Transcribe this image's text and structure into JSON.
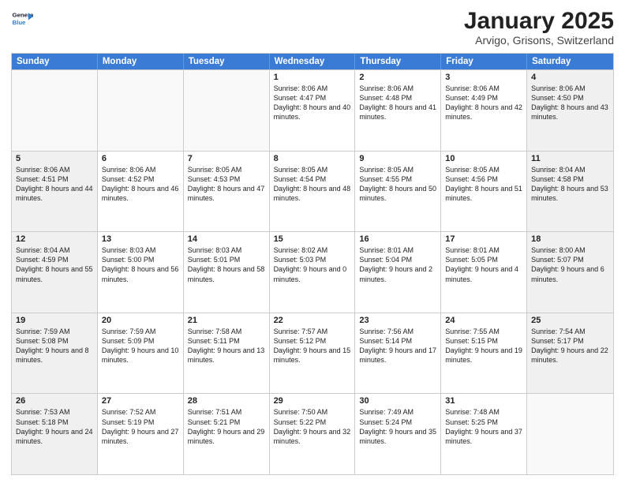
{
  "header": {
    "logo_line1": "General",
    "logo_line2": "Blue",
    "title": "January 2025",
    "subtitle": "Arvigo, Grisons, Switzerland"
  },
  "days_of_week": [
    "Sunday",
    "Monday",
    "Tuesday",
    "Wednesday",
    "Thursday",
    "Friday",
    "Saturday"
  ],
  "weeks": [
    [
      {
        "day": "",
        "text": "",
        "empty": true
      },
      {
        "day": "",
        "text": "",
        "empty": true
      },
      {
        "day": "",
        "text": "",
        "empty": true
      },
      {
        "day": "1",
        "text": "Sunrise: 8:06 AM\nSunset: 4:47 PM\nDaylight: 8 hours and 40 minutes.",
        "empty": false
      },
      {
        "day": "2",
        "text": "Sunrise: 8:06 AM\nSunset: 4:48 PM\nDaylight: 8 hours and 41 minutes.",
        "empty": false
      },
      {
        "day": "3",
        "text": "Sunrise: 8:06 AM\nSunset: 4:49 PM\nDaylight: 8 hours and 42 minutes.",
        "empty": false
      },
      {
        "day": "4",
        "text": "Sunrise: 8:06 AM\nSunset: 4:50 PM\nDaylight: 8 hours and 43 minutes.",
        "empty": false,
        "shaded": true
      }
    ],
    [
      {
        "day": "5",
        "text": "Sunrise: 8:06 AM\nSunset: 4:51 PM\nDaylight: 8 hours and 44 minutes.",
        "empty": false,
        "shaded": true
      },
      {
        "day": "6",
        "text": "Sunrise: 8:06 AM\nSunset: 4:52 PM\nDaylight: 8 hours and 46 minutes.",
        "empty": false
      },
      {
        "day": "7",
        "text": "Sunrise: 8:05 AM\nSunset: 4:53 PM\nDaylight: 8 hours and 47 minutes.",
        "empty": false
      },
      {
        "day": "8",
        "text": "Sunrise: 8:05 AM\nSunset: 4:54 PM\nDaylight: 8 hours and 48 minutes.",
        "empty": false
      },
      {
        "day": "9",
        "text": "Sunrise: 8:05 AM\nSunset: 4:55 PM\nDaylight: 8 hours and 50 minutes.",
        "empty": false
      },
      {
        "day": "10",
        "text": "Sunrise: 8:05 AM\nSunset: 4:56 PM\nDaylight: 8 hours and 51 minutes.",
        "empty": false
      },
      {
        "day": "11",
        "text": "Sunrise: 8:04 AM\nSunset: 4:58 PM\nDaylight: 8 hours and 53 minutes.",
        "empty": false,
        "shaded": true
      }
    ],
    [
      {
        "day": "12",
        "text": "Sunrise: 8:04 AM\nSunset: 4:59 PM\nDaylight: 8 hours and 55 minutes.",
        "empty": false,
        "shaded": true
      },
      {
        "day": "13",
        "text": "Sunrise: 8:03 AM\nSunset: 5:00 PM\nDaylight: 8 hours and 56 minutes.",
        "empty": false
      },
      {
        "day": "14",
        "text": "Sunrise: 8:03 AM\nSunset: 5:01 PM\nDaylight: 8 hours and 58 minutes.",
        "empty": false
      },
      {
        "day": "15",
        "text": "Sunrise: 8:02 AM\nSunset: 5:03 PM\nDaylight: 9 hours and 0 minutes.",
        "empty": false
      },
      {
        "day": "16",
        "text": "Sunrise: 8:01 AM\nSunset: 5:04 PM\nDaylight: 9 hours and 2 minutes.",
        "empty": false
      },
      {
        "day": "17",
        "text": "Sunrise: 8:01 AM\nSunset: 5:05 PM\nDaylight: 9 hours and 4 minutes.",
        "empty": false
      },
      {
        "day": "18",
        "text": "Sunrise: 8:00 AM\nSunset: 5:07 PM\nDaylight: 9 hours and 6 minutes.",
        "empty": false,
        "shaded": true
      }
    ],
    [
      {
        "day": "19",
        "text": "Sunrise: 7:59 AM\nSunset: 5:08 PM\nDaylight: 9 hours and 8 minutes.",
        "empty": false,
        "shaded": true
      },
      {
        "day": "20",
        "text": "Sunrise: 7:59 AM\nSunset: 5:09 PM\nDaylight: 9 hours and 10 minutes.",
        "empty": false
      },
      {
        "day": "21",
        "text": "Sunrise: 7:58 AM\nSunset: 5:11 PM\nDaylight: 9 hours and 13 minutes.",
        "empty": false
      },
      {
        "day": "22",
        "text": "Sunrise: 7:57 AM\nSunset: 5:12 PM\nDaylight: 9 hours and 15 minutes.",
        "empty": false
      },
      {
        "day": "23",
        "text": "Sunrise: 7:56 AM\nSunset: 5:14 PM\nDaylight: 9 hours and 17 minutes.",
        "empty": false
      },
      {
        "day": "24",
        "text": "Sunrise: 7:55 AM\nSunset: 5:15 PM\nDaylight: 9 hours and 19 minutes.",
        "empty": false
      },
      {
        "day": "25",
        "text": "Sunrise: 7:54 AM\nSunset: 5:17 PM\nDaylight: 9 hours and 22 minutes.",
        "empty": false,
        "shaded": true
      }
    ],
    [
      {
        "day": "26",
        "text": "Sunrise: 7:53 AM\nSunset: 5:18 PM\nDaylight: 9 hours and 24 minutes.",
        "empty": false,
        "shaded": true
      },
      {
        "day": "27",
        "text": "Sunrise: 7:52 AM\nSunset: 5:19 PM\nDaylight: 9 hours and 27 minutes.",
        "empty": false
      },
      {
        "day": "28",
        "text": "Sunrise: 7:51 AM\nSunset: 5:21 PM\nDaylight: 9 hours and 29 minutes.",
        "empty": false
      },
      {
        "day": "29",
        "text": "Sunrise: 7:50 AM\nSunset: 5:22 PM\nDaylight: 9 hours and 32 minutes.",
        "empty": false
      },
      {
        "day": "30",
        "text": "Sunrise: 7:49 AM\nSunset: 5:24 PM\nDaylight: 9 hours and 35 minutes.",
        "empty": false
      },
      {
        "day": "31",
        "text": "Sunrise: 7:48 AM\nSunset: 5:25 PM\nDaylight: 9 hours and 37 minutes.",
        "empty": false
      },
      {
        "day": "",
        "text": "",
        "empty": true
      }
    ]
  ]
}
